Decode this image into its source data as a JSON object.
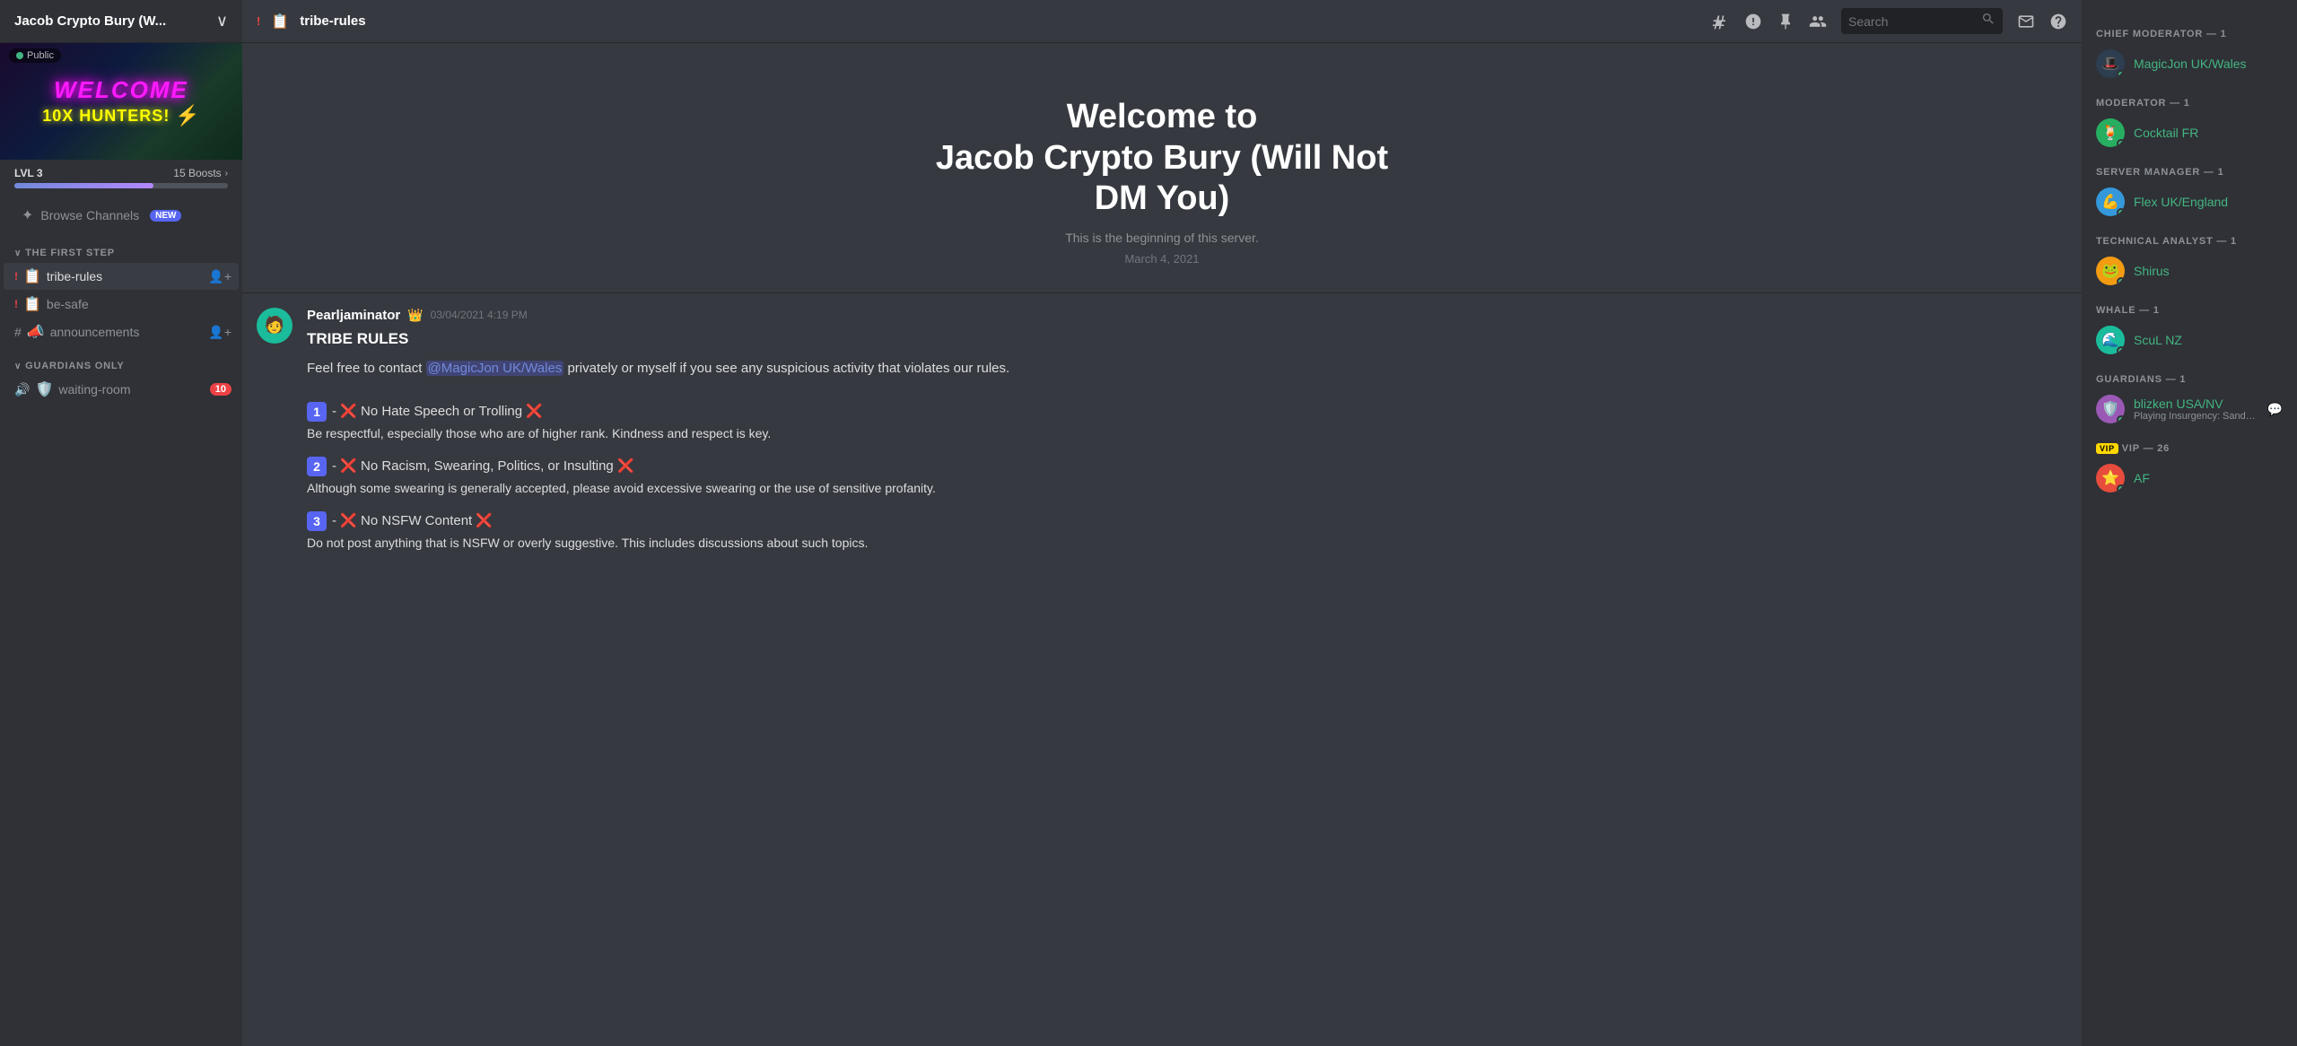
{
  "server": {
    "name": "Jacob Crypto Bury (W...",
    "public_label": "Public",
    "lvl": "LVL 3",
    "boosts": "15 Boosts",
    "banner_welcome": "WELCOME",
    "banner_subtitle": "10X HUNTERS!",
    "progress_percent": 65
  },
  "sidebar": {
    "browse_channels": "Browse Channels",
    "browse_new_badge": "NEW",
    "categories": [
      {
        "name": "THE FIRST STEP",
        "channels": [
          {
            "type": "text",
            "prefix": "📋",
            "name": "tribe-rules",
            "active": true,
            "has_alert": false,
            "icon": "!"
          },
          {
            "type": "text",
            "prefix": "📋",
            "name": "be-safe",
            "has_alert": false,
            "icon": "!"
          },
          {
            "type": "text",
            "prefix": "📣",
            "name": "announcements",
            "has_alert": false,
            "has_add": true
          }
        ]
      },
      {
        "name": "GUARDIANS ONLY",
        "channels": [
          {
            "type": "voice",
            "prefix": "🛡️",
            "name": "waiting-room",
            "badge": "10"
          }
        ]
      }
    ]
  },
  "header": {
    "channel_icon": "!",
    "channel_prefix": "📋",
    "channel_name": "tribe-rules",
    "actions": {
      "hash_label": "#",
      "bell_label": "🔔",
      "pin_label": "📌",
      "members_label": "👤",
      "search_placeholder": "Search",
      "inbox_label": "📥",
      "help_label": "❓"
    }
  },
  "welcome": {
    "title_line1": "Welcome to",
    "title_line2": "Jacob Crypto Bury (Will Not",
    "title_line3": "DM You)",
    "description": "This is the beginning of this server.",
    "date": "March 4, 2021"
  },
  "message": {
    "author": "Pearljaminator",
    "author_crown": "👑",
    "timestamp": "03/04/2021 4:19 PM",
    "title": "TRIBE RULES",
    "intro": "Feel free to contact @MagicJon UK/Wales privately or myself if you see any suspicious activity that violates our rules.",
    "rules": [
      {
        "number": "1",
        "text": "❌ No Hate Speech or Trolling ❌",
        "desc": "Be respectful, especially those who are of higher rank. Kindness and respect is key."
      },
      {
        "number": "2",
        "text": "❌ No Racism, Swearing, Politics, or Insulting ❌",
        "desc": "Although some swearing is generally accepted, please avoid excessive swearing or the use of sensitive profanity."
      },
      {
        "number": "3",
        "text": "❌ No NSFW Content ❌",
        "desc": "Do not post anything that is NSFW or overly suggestive. This includes discussions about such topics."
      }
    ]
  },
  "members": {
    "roles": [
      {
        "role": "CHIEF MODERATOR",
        "count": 1,
        "label": "CHIEF MODERATOR — 1",
        "members": [
          {
            "name": "MagicJon UK/Wales",
            "color": "green",
            "status": "online",
            "avatar_emoji": "🎩"
          }
        ]
      },
      {
        "role": "MODERATOR",
        "count": 1,
        "label": "MODERATOR — 1",
        "members": [
          {
            "name": "Cocktail FR",
            "color": "green",
            "status": "online",
            "avatar_emoji": "🍹"
          }
        ]
      },
      {
        "role": "SERVER MANAGER",
        "count": 1,
        "label": "SERVER MANAGER — 1",
        "members": [
          {
            "name": "Flex UK/England",
            "color": "green",
            "status": "online",
            "avatar_emoji": "💪"
          }
        ]
      },
      {
        "role": "TECHNICAL ANALYST",
        "count": 1,
        "label": "TECHNICAL ANALYST — 1",
        "members": [
          {
            "name": "Shirus",
            "color": "green",
            "status": "online",
            "avatar_emoji": "🐸"
          }
        ]
      },
      {
        "role": "WHALE",
        "count": 1,
        "label": "WHALE — 1",
        "members": [
          {
            "name": "ScuL NZ",
            "color": "green",
            "status": "online",
            "avatar_emoji": "🌊"
          }
        ]
      },
      {
        "role": "GUARDIANS",
        "count": 1,
        "label": "GUARDIANS — 1",
        "members": [
          {
            "name": "blizken USA/NV",
            "color": "green",
            "status": "online",
            "avatar_emoji": "🛡️",
            "status_text": "Playing Insurgency: Sands..."
          }
        ]
      },
      {
        "role": "VIP",
        "count": 26,
        "label": "VIP — 26",
        "members": [
          {
            "name": "AF",
            "color": "green",
            "status": "online",
            "avatar_emoji": "⭐"
          }
        ]
      }
    ]
  }
}
